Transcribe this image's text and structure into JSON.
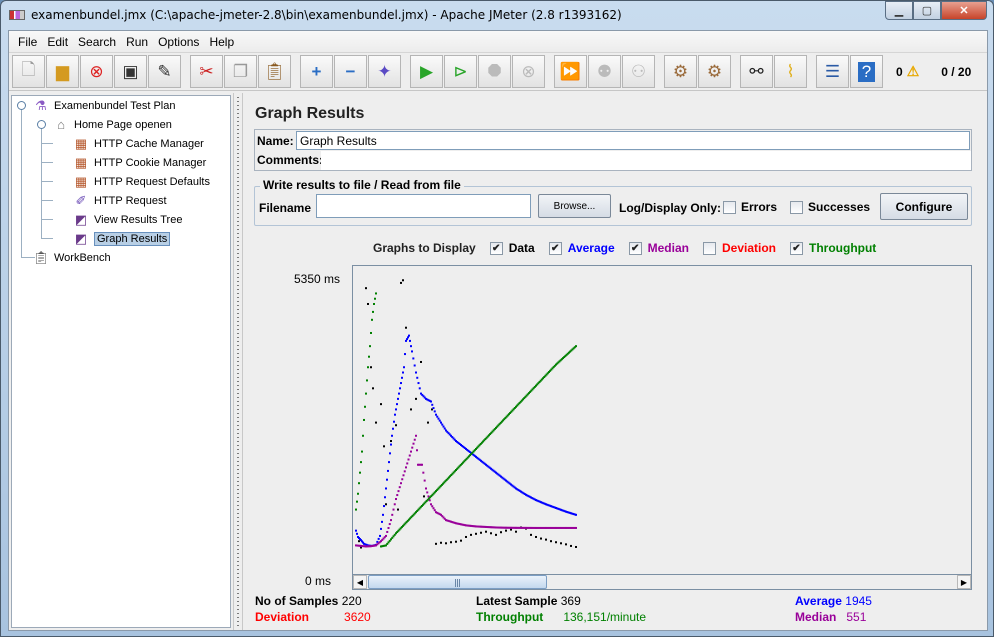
{
  "window": {
    "title": "examenbundel.jmx (C:\\apache-jmeter-2.8\\bin\\examenbundel.jmx) - Apache JMeter (2.8 r1393162)",
    "controls": [
      "minimize",
      "maximize",
      "close"
    ]
  },
  "menu": [
    "File",
    "Edit",
    "Search",
    "Run",
    "Options",
    "Help"
  ],
  "toolbar": {
    "buttons": [
      {
        "name": "new",
        "icon": "new-file-icon"
      },
      {
        "name": "open",
        "icon": "open-folder-icon"
      },
      {
        "name": "close",
        "icon": "close-file-icon"
      },
      {
        "name": "save",
        "icon": "save-icon"
      },
      {
        "name": "save-as",
        "icon": "save-as-icon"
      },
      {
        "name": "cut",
        "icon": "scissors-icon"
      },
      {
        "name": "copy",
        "icon": "copy-icon"
      },
      {
        "name": "paste",
        "icon": "paste-icon"
      },
      {
        "name": "expand",
        "icon": "plus-icon"
      },
      {
        "name": "collapse",
        "icon": "minus-icon"
      },
      {
        "name": "toggle",
        "icon": "toggle-icon"
      },
      {
        "name": "start",
        "icon": "play-icon"
      },
      {
        "name": "start-no-pauses",
        "icon": "play-no-timers-icon"
      },
      {
        "name": "stop",
        "icon": "stop-icon",
        "disabled": true
      },
      {
        "name": "shutdown",
        "icon": "shutdown-icon",
        "disabled": true
      },
      {
        "name": "remote-start-all",
        "icon": "remote-start-icon"
      },
      {
        "name": "remote-stop-all",
        "icon": "remote-stop-icon",
        "disabled": true
      },
      {
        "name": "remote-shutdown-all",
        "icon": "remote-shutdown-icon",
        "disabled": true
      },
      {
        "name": "clear",
        "icon": "broom-gear-icon"
      },
      {
        "name": "clear-all",
        "icon": "broom-gear-all-icon"
      },
      {
        "name": "search",
        "icon": "binoculars-icon"
      },
      {
        "name": "reset-search",
        "icon": "broom-icon"
      },
      {
        "name": "function-helper",
        "icon": "function-list-icon"
      },
      {
        "name": "help",
        "icon": "help-book-icon"
      }
    ],
    "error_count": "0",
    "thread_count": "0 / 20"
  },
  "tree": {
    "items": [
      {
        "label": "Examenbundel Test Plan",
        "icon": "test-plan-flask-icon",
        "level": 0
      },
      {
        "label": "Home Page openen",
        "icon": "thread-group-spool-icon",
        "level": 1
      },
      {
        "label": "HTTP Cache Manager",
        "icon": "config-element-icon",
        "level": 2
      },
      {
        "label": "HTTP Cookie Manager",
        "icon": "config-element-icon",
        "level": 2
      },
      {
        "label": "HTTP Request Defaults",
        "icon": "config-element-icon",
        "level": 2
      },
      {
        "label": "HTTP Request",
        "icon": "sampler-pipette-icon",
        "level": 2
      },
      {
        "label": "View Results Tree",
        "icon": "listener-gauge-icon",
        "level": 2
      },
      {
        "label": "Graph Results",
        "icon": "listener-gauge-icon",
        "level": 2,
        "selected": true
      },
      {
        "label": "WorkBench",
        "icon": "workbench-clipboard-icon",
        "level": 0
      }
    ]
  },
  "panel": {
    "title": "Graph Results",
    "name_label": "Name:",
    "name_value": "Graph Results",
    "comments_label": "Comments:",
    "comments_value": "",
    "file_group_title": "Write results to file / Read from file",
    "filename_label": "Filename",
    "filename_value": "",
    "browse_label": "Browse...",
    "log_display_label": "Log/Display Only:",
    "errors_label": "Errors",
    "errors_checked": false,
    "successes_label": "Successes",
    "successes_checked": false,
    "configure_label": "Configure"
  },
  "graphs_to_display": {
    "label": "Graphs to Display",
    "options": [
      {
        "label": "Data",
        "checked": true,
        "color": "#000000"
      },
      {
        "label": "Average",
        "checked": true,
        "color": "#0000ff"
      },
      {
        "label": "Median",
        "checked": true,
        "color": "#990099"
      },
      {
        "label": "Deviation",
        "checked": false,
        "color": "#ff0000"
      },
      {
        "label": "Throughput",
        "checked": true,
        "color": "#008000"
      }
    ]
  },
  "chart_data": {
    "type": "scatter",
    "ylabel_max": "5350  ms",
    "ylabel_min": "0  ms",
    "ylim": [
      0,
      5350
    ],
    "x_samples": [
      0,
      220
    ],
    "series": [
      {
        "name": "Data",
        "color": "#000000",
        "points": [
          [
            3,
            300
          ],
          [
            5,
            180
          ],
          [
            10,
            5100
          ],
          [
            12,
            4800
          ],
          [
            15,
            3600
          ],
          [
            17,
            3200
          ],
          [
            20,
            2550
          ],
          [
            25,
            2900
          ],
          [
            28,
            2100
          ],
          [
            30,
            1000
          ],
          [
            35,
            2200
          ],
          [
            40,
            2500
          ],
          [
            42,
            900
          ],
          [
            45,
            5200
          ],
          [
            47,
            5250
          ],
          [
            50,
            4350
          ],
          [
            55,
            2800
          ],
          [
            60,
            3000
          ],
          [
            65,
            3700
          ],
          [
            68,
            1150
          ],
          [
            72,
            2550
          ],
          [
            76,
            2800
          ],
          [
            80,
            250
          ],
          [
            85,
            270
          ],
          [
            90,
            260
          ],
          [
            95,
            280
          ],
          [
            100,
            290
          ],
          [
            105,
            310
          ],
          [
            110,
            380
          ],
          [
            115,
            420
          ],
          [
            120,
            440
          ],
          [
            125,
            460
          ],
          [
            130,
            480
          ],
          [
            135,
            450
          ],
          [
            140,
            420
          ],
          [
            145,
            470
          ],
          [
            150,
            500
          ],
          [
            155,
            520
          ],
          [
            160,
            480
          ],
          [
            165,
            560
          ],
          [
            170,
            540
          ],
          [
            175,
            420
          ],
          [
            180,
            380
          ],
          [
            185,
            350
          ],
          [
            190,
            330
          ],
          [
            195,
            300
          ],
          [
            200,
            280
          ],
          [
            205,
            260
          ],
          [
            210,
            240
          ],
          [
            215,
            210
          ],
          [
            220,
            190
          ]
        ]
      },
      {
        "name": "Average",
        "color": "#0000ff",
        "points": [
          [
            0,
            500
          ],
          [
            2,
            380
          ],
          [
            5,
            320
          ],
          [
            8,
            250
          ],
          [
            12,
            220
          ],
          [
            16,
            210
          ],
          [
            20,
            230
          ],
          [
            24,
            400
          ],
          [
            27,
            800
          ],
          [
            30,
            1300
          ],
          [
            33,
            1800
          ],
          [
            36,
            2300
          ],
          [
            39,
            2700
          ],
          [
            42,
            3000
          ],
          [
            45,
            3300
          ],
          [
            48,
            3600
          ],
          [
            50,
            4100
          ],
          [
            53,
            4200
          ],
          [
            56,
            3900
          ],
          [
            60,
            3500
          ],
          [
            65,
            3100
          ],
          [
            70,
            3000
          ],
          [
            75,
            2950
          ],
          [
            80,
            2700
          ],
          [
            90,
            2400
          ],
          [
            100,
            2200
          ],
          [
            110,
            2050
          ],
          [
            120,
            1900
          ],
          [
            130,
            1750
          ],
          [
            140,
            1600
          ],
          [
            150,
            1450
          ],
          [
            160,
            1300
          ],
          [
            170,
            1180
          ],
          [
            180,
            1080
          ],
          [
            190,
            1000
          ],
          [
            200,
            930
          ],
          [
            210,
            860
          ],
          [
            220,
            800
          ]
        ]
      },
      {
        "name": "Median",
        "color": "#990099",
        "points": [
          [
            0,
            220
          ],
          [
            5,
            210
          ],
          [
            10,
            200
          ],
          [
            15,
            205
          ],
          [
            20,
            220
          ],
          [
            25,
            300
          ],
          [
            30,
            400
          ],
          [
            35,
            700
          ],
          [
            40,
            1100
          ],
          [
            45,
            1400
          ],
          [
            50,
            1700
          ],
          [
            55,
            2000
          ],
          [
            60,
            2300
          ],
          [
            62,
            1750
          ],
          [
            66,
            1750
          ],
          [
            70,
            1300
          ],
          [
            75,
            1000
          ],
          [
            80,
            850
          ],
          [
            85,
            800
          ],
          [
            90,
            700
          ],
          [
            100,
            640
          ],
          [
            110,
            600
          ],
          [
            120,
            580
          ],
          [
            130,
            570
          ],
          [
            140,
            560
          ],
          [
            150,
            555
          ],
          [
            160,
            553
          ],
          [
            170,
            552
          ],
          [
            180,
            551
          ],
          [
            190,
            551
          ],
          [
            200,
            551
          ],
          [
            210,
            551
          ],
          [
            220,
            551
          ]
        ]
      },
      {
        "name": "Throughput",
        "color": "#008000",
        "points": [
          [
            0,
            900
          ],
          [
            2,
            1200
          ],
          [
            4,
            1600
          ],
          [
            6,
            2000
          ],
          [
            8,
            2600
          ],
          [
            10,
            3100
          ],
          [
            12,
            3600
          ],
          [
            14,
            4000
          ],
          [
            16,
            4500
          ],
          [
            18,
            4800
          ],
          [
            20,
            5000
          ],
          [
            25,
            200
          ],
          [
            30,
            220
          ],
          [
            40,
            450
          ],
          [
            60,
            850
          ],
          [
            80,
            1250
          ],
          [
            100,
            1650
          ],
          [
            120,
            2050
          ],
          [
            140,
            2450
          ],
          [
            160,
            2850
          ],
          [
            180,
            3250
          ],
          [
            200,
            3650
          ],
          [
            220,
            4000
          ]
        ]
      }
    ]
  },
  "stats": {
    "samples_label": "No of Samples",
    "samples_value": "220",
    "latest_label": "Latest Sample",
    "latest_value": "369",
    "average_label": "Average",
    "average_value": "1945",
    "deviation_label": "Deviation",
    "deviation_value": "3620",
    "throughput_label": "Throughput",
    "throughput_value": "136,151/minute",
    "median_label": "Median",
    "median_value": "551"
  }
}
